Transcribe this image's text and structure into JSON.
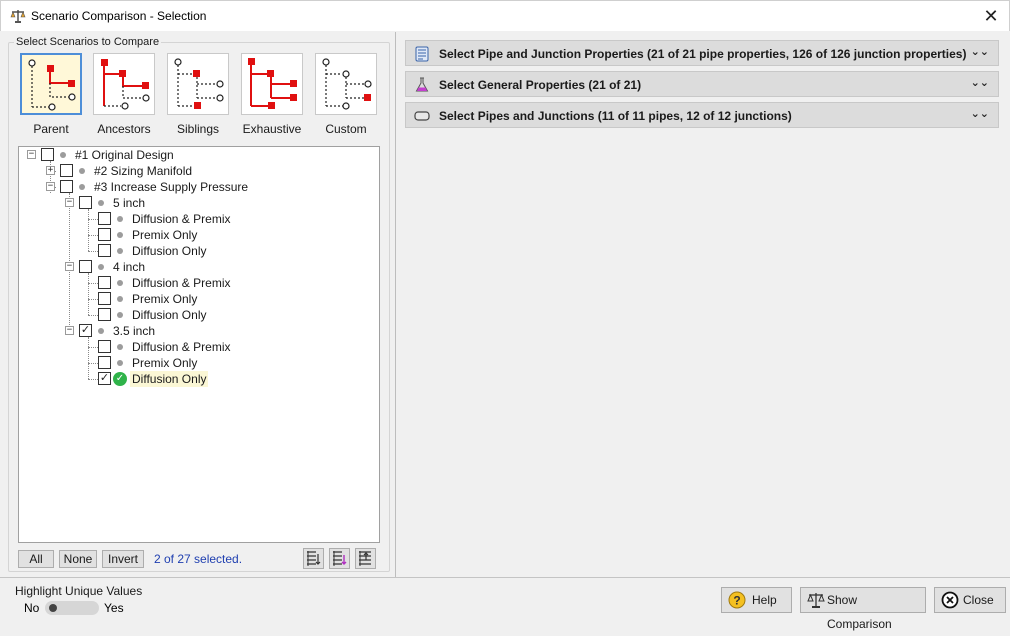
{
  "window": {
    "title": "Scenario Comparison - Selection"
  },
  "left": {
    "group_label": "Select Scenarios to Compare",
    "presets": [
      {
        "label": "Parent",
        "active": true
      },
      {
        "label": "Ancestors",
        "active": false
      },
      {
        "label": "Siblings",
        "active": false
      },
      {
        "label": "Exhaustive",
        "active": false
      },
      {
        "label": "Custom",
        "active": false
      }
    ],
    "tree": [
      {
        "label": "#1 Original Design",
        "checked": false
      },
      {
        "label": "#2 Sizing Manifold",
        "checked": false
      },
      {
        "label": "#3 Increase Supply Pressure",
        "checked": false
      },
      {
        "label": "5 inch",
        "checked": false
      },
      {
        "label": "Diffusion & Premix",
        "checked": false
      },
      {
        "label": "Premix Only",
        "checked": false
      },
      {
        "label": "Diffusion Only",
        "checked": false
      },
      {
        "label": "4 inch",
        "checked": false
      },
      {
        "label": "Diffusion & Premix",
        "checked": false
      },
      {
        "label": "Premix Only",
        "checked": false
      },
      {
        "label": "Diffusion Only",
        "checked": false
      },
      {
        "label": "3.5 inch",
        "checked": true
      },
      {
        "label": "Diffusion & Premix",
        "checked": false
      },
      {
        "label": "Premix Only",
        "checked": false
      },
      {
        "label": "Diffusion Only",
        "checked": true,
        "current": true
      }
    ],
    "buttons": {
      "all": "All",
      "none": "None",
      "invert": "Invert"
    },
    "selected_count": "2 of 27 selected."
  },
  "right": {
    "sections": [
      {
        "label": "Select Pipe and Junction Properties (21 of 21  pipe properties, 126 of 126 junction properties)",
        "icon": "properties-icon"
      },
      {
        "label": "Select General Properties (21 of 21)",
        "icon": "flask-icon"
      },
      {
        "label": "Select Pipes and Junctions (11 of 11  pipes, 12 of 12 junctions)",
        "icon": "pipe-icon"
      }
    ]
  },
  "footer": {
    "highlight_label": "Highlight Unique Values",
    "toggle_no": "No",
    "toggle_yes": "Yes",
    "toggle_on": false,
    "help": "Help",
    "show_comparison": "Show Comparison",
    "close": "Close"
  }
}
